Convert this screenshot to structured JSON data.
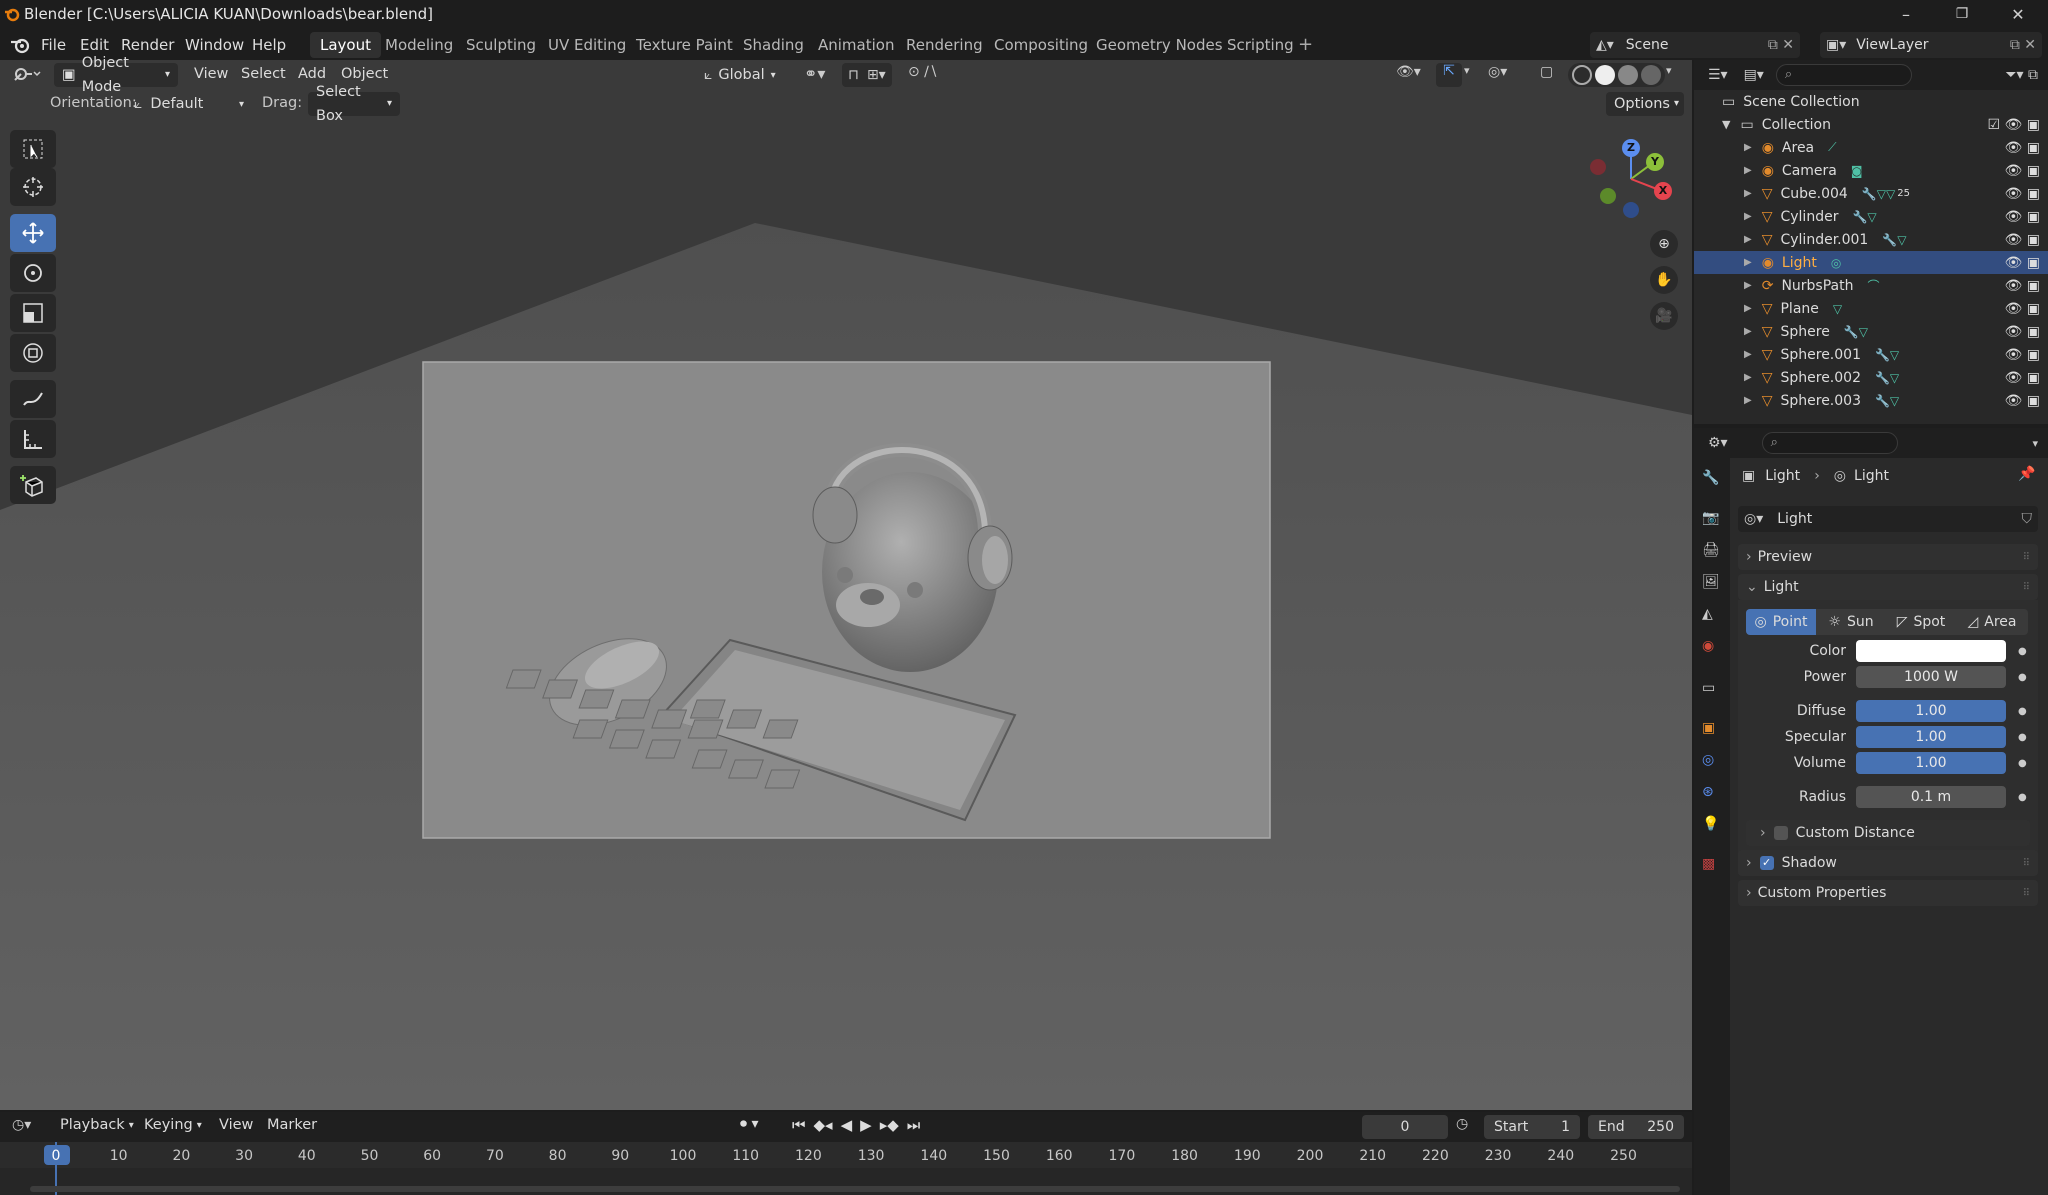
{
  "window": {
    "title": "Blender [C:\\Users\\ALICIA KUAN\\Downloads\\bear.blend]",
    "controls": [
      "–",
      "❐",
      "✕"
    ]
  },
  "menu": [
    "File",
    "Edit",
    "Render",
    "Window",
    "Help"
  ],
  "workspaces": [
    "Layout",
    "Modeling",
    "Sculpting",
    "UV Editing",
    "Texture Paint",
    "Shading",
    "Animation",
    "Rendering",
    "Compositing",
    "Geometry Nodes",
    "Scripting"
  ],
  "active_workspace": "Layout",
  "scene": {
    "scene_name": "Scene",
    "view_layer": "ViewLayer"
  },
  "viewport_header": {
    "mode": "Object Mode",
    "menus": [
      "View",
      "Select",
      "Add",
      "Object"
    ],
    "transform_orientation": "Global"
  },
  "tool_settings": {
    "orientation_label": "Orientation:",
    "orientation_value": "Default",
    "drag_label": "Drag:",
    "drag_value": "Select Box",
    "options": "Options"
  },
  "gizmo": {
    "z": "Z",
    "y": "Y",
    "x": "X"
  },
  "outliner": {
    "root": "Scene Collection",
    "collection": "Collection",
    "items": [
      {
        "name": "Area",
        "selected": false
      },
      {
        "name": "Camera",
        "selected": false
      },
      {
        "name": "Cube.004",
        "selected": false,
        "badge": "25"
      },
      {
        "name": "Cylinder",
        "selected": false
      },
      {
        "name": "Cylinder.001",
        "selected": false
      },
      {
        "name": "Light",
        "selected": true
      },
      {
        "name": "NurbsPath",
        "selected": false
      },
      {
        "name": "Plane",
        "selected": false
      },
      {
        "name": "Sphere",
        "selected": false
      },
      {
        "name": "Sphere.001",
        "selected": false
      },
      {
        "name": "Sphere.002",
        "selected": false
      },
      {
        "name": "Sphere.003",
        "selected": false
      }
    ]
  },
  "properties": {
    "breadcrumb_object": "Light",
    "breadcrumb_data": "Light",
    "datablock": "Light",
    "panels": {
      "preview": "Preview",
      "light": "Light",
      "custom_distance": "Custom Distance",
      "shadow": "Shadow",
      "custom_properties": "Custom Properties"
    },
    "light_types": [
      "Point",
      "Sun",
      "Spot",
      "Area"
    ],
    "active_light_type": "Point",
    "fields": {
      "color_label": "Color",
      "color_value": "#ffffff",
      "power_label": "Power",
      "power_value": "1000 W",
      "diffuse_label": "Diffuse",
      "diffuse_value": "1.00",
      "specular_label": "Specular",
      "specular_value": "1.00",
      "volume_label": "Volume",
      "volume_value": "1.00",
      "radius_label": "Radius",
      "radius_value": "0.1 m"
    },
    "shadow_enabled": true,
    "custom_distance_enabled": false
  },
  "timeline": {
    "menus": [
      "Playback",
      "Keying",
      "View",
      "Marker"
    ],
    "current_frame": "0",
    "start_label": "Start",
    "start_value": "1",
    "end_label": "End",
    "end_value": "250",
    "ticks": [
      "0",
      "10",
      "20",
      "30",
      "40",
      "50",
      "60",
      "70",
      "80",
      "90",
      "100",
      "110",
      "120",
      "130",
      "140",
      "150",
      "160",
      "170",
      "180",
      "190",
      "200",
      "210",
      "220",
      "230",
      "240",
      "250"
    ]
  },
  "colors": {
    "accent": "#4772b3",
    "selection": "#334d80",
    "frame_marker": "#4772b3"
  }
}
